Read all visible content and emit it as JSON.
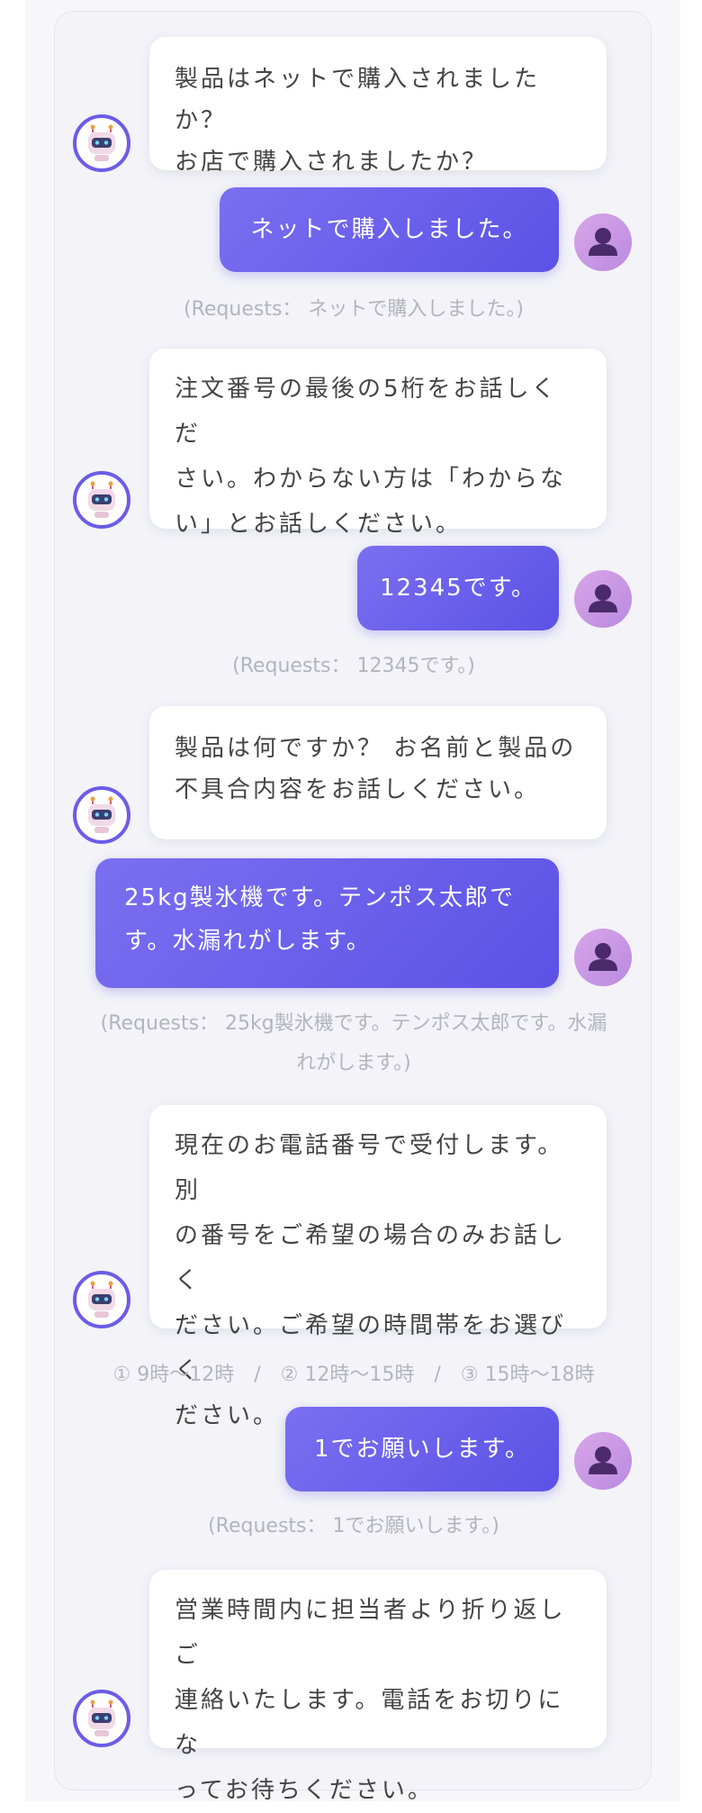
{
  "colors": {
    "accent": "#6c5ce7",
    "user_bubble_start": "#7b6ff0",
    "user_bubble_end": "#5b52e6",
    "bot_bubble": "#ffffff",
    "panel_background": "#f3f3f8",
    "hint_text": "#b4b4bc"
  },
  "icons": {
    "bot": "robot-icon",
    "user": "person-icon"
  },
  "conversation": {
    "messages": [
      {
        "role": "bot",
        "text": "製品はネットで購入されましたか？\nお店で購入されましたか？"
      },
      {
        "role": "user",
        "text": "ネットで購入しました。"
      },
      {
        "role": "requests",
        "text": "(Requests： ネットで購入しました。)"
      },
      {
        "role": "bot",
        "text": "注文番号の最後の5桁をお話しくだ\nさい。わからない方は「わからな\nい」とお話しください。"
      },
      {
        "role": "user",
        "text": "12345です。"
      },
      {
        "role": "requests",
        "text": "(Requests： 12345です。)"
      },
      {
        "role": "bot",
        "text": "製品は何ですか？ お名前と製品の\n不具合内容をお話しください。"
      },
      {
        "role": "user",
        "text": "25kg製氷機です。テンポス太郎で\nす。水漏れがします。"
      },
      {
        "role": "requests",
        "text": "(Requests： 25kg製氷機です。テンポス太郎です。水漏\nれがします。)"
      },
      {
        "role": "bot",
        "text": "現在のお電話番号で受付します。別\nの番号をご希望の場合のみお話しく\nださい。ご希望の時間帯をお選びく\nださい。"
      },
      {
        "role": "options",
        "text": "① 9時〜12時　/　② 12時〜15時　/　③ 15時〜18時"
      },
      {
        "role": "user",
        "text": "1でお願いします。"
      },
      {
        "role": "requests",
        "text": "(Requests： 1でお願いします。)"
      },
      {
        "role": "bot",
        "text": "営業時間内に担当者より折り返しご\n連絡いたします。電話をお切りにな\nってお待ちください。"
      }
    ]
  }
}
